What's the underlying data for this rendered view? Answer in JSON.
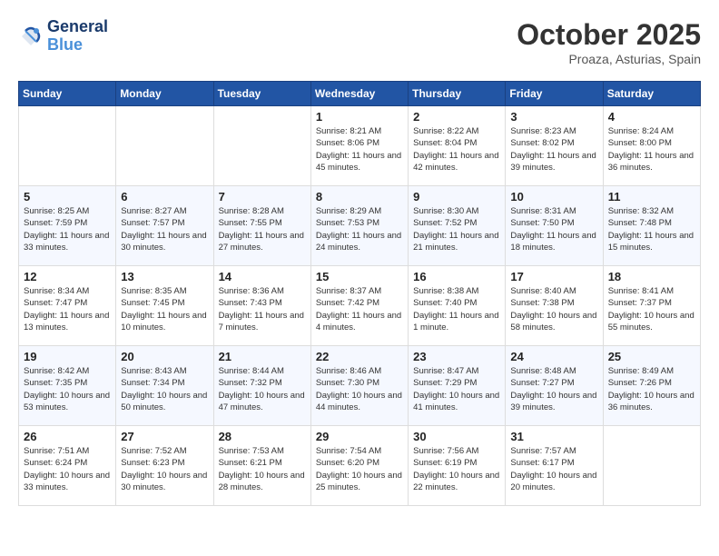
{
  "header": {
    "logo_line1": "General",
    "logo_line2": "Blue",
    "month": "October 2025",
    "location": "Proaza, Asturias, Spain"
  },
  "weekdays": [
    "Sunday",
    "Monday",
    "Tuesday",
    "Wednesday",
    "Thursday",
    "Friday",
    "Saturday"
  ],
  "weeks": [
    [
      {
        "day": "",
        "sunrise": "",
        "sunset": "",
        "daylight": ""
      },
      {
        "day": "",
        "sunrise": "",
        "sunset": "",
        "daylight": ""
      },
      {
        "day": "",
        "sunrise": "",
        "sunset": "",
        "daylight": ""
      },
      {
        "day": "1",
        "sunrise": "Sunrise: 8:21 AM",
        "sunset": "Sunset: 8:06 PM",
        "daylight": "Daylight: 11 hours and 45 minutes."
      },
      {
        "day": "2",
        "sunrise": "Sunrise: 8:22 AM",
        "sunset": "Sunset: 8:04 PM",
        "daylight": "Daylight: 11 hours and 42 minutes."
      },
      {
        "day": "3",
        "sunrise": "Sunrise: 8:23 AM",
        "sunset": "Sunset: 8:02 PM",
        "daylight": "Daylight: 11 hours and 39 minutes."
      },
      {
        "day": "4",
        "sunrise": "Sunrise: 8:24 AM",
        "sunset": "Sunset: 8:00 PM",
        "daylight": "Daylight: 11 hours and 36 minutes."
      }
    ],
    [
      {
        "day": "5",
        "sunrise": "Sunrise: 8:25 AM",
        "sunset": "Sunset: 7:59 PM",
        "daylight": "Daylight: 11 hours and 33 minutes."
      },
      {
        "day": "6",
        "sunrise": "Sunrise: 8:27 AM",
        "sunset": "Sunset: 7:57 PM",
        "daylight": "Daylight: 11 hours and 30 minutes."
      },
      {
        "day": "7",
        "sunrise": "Sunrise: 8:28 AM",
        "sunset": "Sunset: 7:55 PM",
        "daylight": "Daylight: 11 hours and 27 minutes."
      },
      {
        "day": "8",
        "sunrise": "Sunrise: 8:29 AM",
        "sunset": "Sunset: 7:53 PM",
        "daylight": "Daylight: 11 hours and 24 minutes."
      },
      {
        "day": "9",
        "sunrise": "Sunrise: 8:30 AM",
        "sunset": "Sunset: 7:52 PM",
        "daylight": "Daylight: 11 hours and 21 minutes."
      },
      {
        "day": "10",
        "sunrise": "Sunrise: 8:31 AM",
        "sunset": "Sunset: 7:50 PM",
        "daylight": "Daylight: 11 hours and 18 minutes."
      },
      {
        "day": "11",
        "sunrise": "Sunrise: 8:32 AM",
        "sunset": "Sunset: 7:48 PM",
        "daylight": "Daylight: 11 hours and 15 minutes."
      }
    ],
    [
      {
        "day": "12",
        "sunrise": "Sunrise: 8:34 AM",
        "sunset": "Sunset: 7:47 PM",
        "daylight": "Daylight: 11 hours and 13 minutes."
      },
      {
        "day": "13",
        "sunrise": "Sunrise: 8:35 AM",
        "sunset": "Sunset: 7:45 PM",
        "daylight": "Daylight: 11 hours and 10 minutes."
      },
      {
        "day": "14",
        "sunrise": "Sunrise: 8:36 AM",
        "sunset": "Sunset: 7:43 PM",
        "daylight": "Daylight: 11 hours and 7 minutes."
      },
      {
        "day": "15",
        "sunrise": "Sunrise: 8:37 AM",
        "sunset": "Sunset: 7:42 PM",
        "daylight": "Daylight: 11 hours and 4 minutes."
      },
      {
        "day": "16",
        "sunrise": "Sunrise: 8:38 AM",
        "sunset": "Sunset: 7:40 PM",
        "daylight": "Daylight: 11 hours and 1 minute."
      },
      {
        "day": "17",
        "sunrise": "Sunrise: 8:40 AM",
        "sunset": "Sunset: 7:38 PM",
        "daylight": "Daylight: 10 hours and 58 minutes."
      },
      {
        "day": "18",
        "sunrise": "Sunrise: 8:41 AM",
        "sunset": "Sunset: 7:37 PM",
        "daylight": "Daylight: 10 hours and 55 minutes."
      }
    ],
    [
      {
        "day": "19",
        "sunrise": "Sunrise: 8:42 AM",
        "sunset": "Sunset: 7:35 PM",
        "daylight": "Daylight: 10 hours and 53 minutes."
      },
      {
        "day": "20",
        "sunrise": "Sunrise: 8:43 AM",
        "sunset": "Sunset: 7:34 PM",
        "daylight": "Daylight: 10 hours and 50 minutes."
      },
      {
        "day": "21",
        "sunrise": "Sunrise: 8:44 AM",
        "sunset": "Sunset: 7:32 PM",
        "daylight": "Daylight: 10 hours and 47 minutes."
      },
      {
        "day": "22",
        "sunrise": "Sunrise: 8:46 AM",
        "sunset": "Sunset: 7:30 PM",
        "daylight": "Daylight: 10 hours and 44 minutes."
      },
      {
        "day": "23",
        "sunrise": "Sunrise: 8:47 AM",
        "sunset": "Sunset: 7:29 PM",
        "daylight": "Daylight: 10 hours and 41 minutes."
      },
      {
        "day": "24",
        "sunrise": "Sunrise: 8:48 AM",
        "sunset": "Sunset: 7:27 PM",
        "daylight": "Daylight: 10 hours and 39 minutes."
      },
      {
        "day": "25",
        "sunrise": "Sunrise: 8:49 AM",
        "sunset": "Sunset: 7:26 PM",
        "daylight": "Daylight: 10 hours and 36 minutes."
      }
    ],
    [
      {
        "day": "26",
        "sunrise": "Sunrise: 7:51 AM",
        "sunset": "Sunset: 6:24 PM",
        "daylight": "Daylight: 10 hours and 33 minutes."
      },
      {
        "day": "27",
        "sunrise": "Sunrise: 7:52 AM",
        "sunset": "Sunset: 6:23 PM",
        "daylight": "Daylight: 10 hours and 30 minutes."
      },
      {
        "day": "28",
        "sunrise": "Sunrise: 7:53 AM",
        "sunset": "Sunset: 6:21 PM",
        "daylight": "Daylight: 10 hours and 28 minutes."
      },
      {
        "day": "29",
        "sunrise": "Sunrise: 7:54 AM",
        "sunset": "Sunset: 6:20 PM",
        "daylight": "Daylight: 10 hours and 25 minutes."
      },
      {
        "day": "30",
        "sunrise": "Sunrise: 7:56 AM",
        "sunset": "Sunset: 6:19 PM",
        "daylight": "Daylight: 10 hours and 22 minutes."
      },
      {
        "day": "31",
        "sunrise": "Sunrise: 7:57 AM",
        "sunset": "Sunset: 6:17 PM",
        "daylight": "Daylight: 10 hours and 20 minutes."
      },
      {
        "day": "",
        "sunrise": "",
        "sunset": "",
        "daylight": ""
      }
    ]
  ]
}
